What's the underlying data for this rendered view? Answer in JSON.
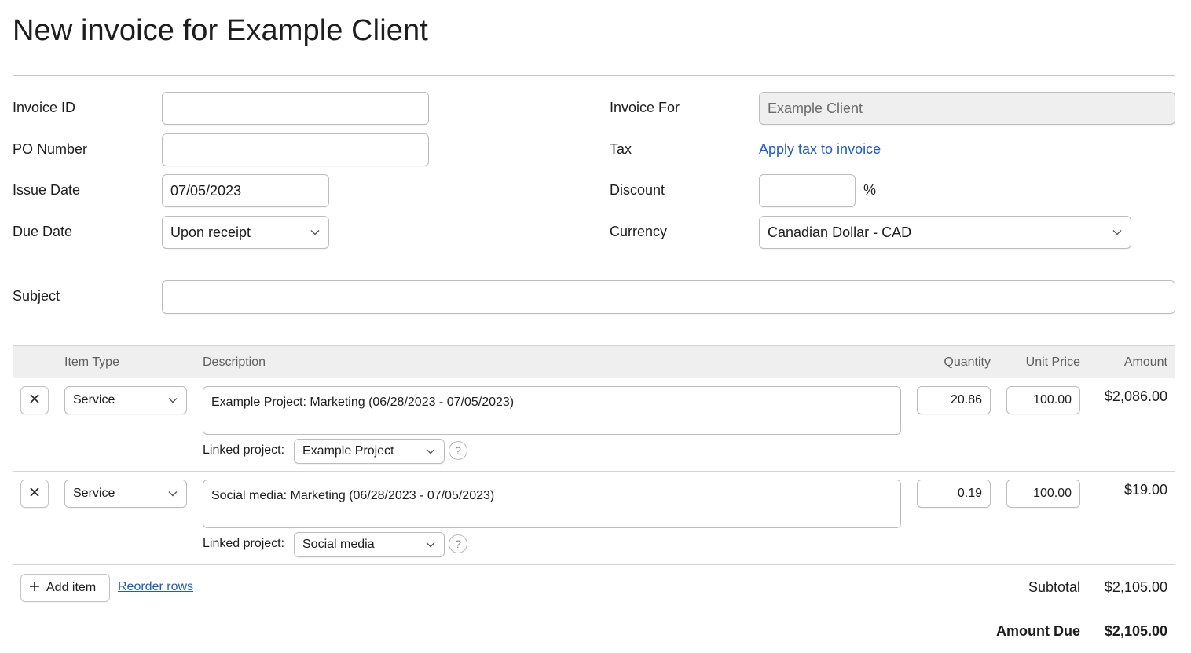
{
  "page": {
    "title": "New invoice for Example Client"
  },
  "form": {
    "invoice_id": {
      "label": "Invoice ID",
      "value": ""
    },
    "po_number": {
      "label": "PO Number",
      "value": ""
    },
    "issue_date": {
      "label": "Issue Date",
      "value": "07/05/2023"
    },
    "due_date": {
      "label": "Due Date",
      "value": "Upon receipt"
    },
    "invoice_for": {
      "label": "Invoice For",
      "value": "Example Client"
    },
    "tax": {
      "label": "Tax",
      "link": "Apply tax to invoice"
    },
    "discount": {
      "label": "Discount",
      "value": "",
      "unit": "%"
    },
    "currency": {
      "label": "Currency",
      "value": "Canadian Dollar - CAD"
    },
    "subject": {
      "label": "Subject",
      "value": ""
    }
  },
  "table": {
    "headers": {
      "item_type": "Item Type",
      "description": "Description",
      "quantity": "Quantity",
      "unit_price": "Unit Price",
      "amount": "Amount"
    },
    "linked_project_label": "Linked project:",
    "help_glyph": "?",
    "rows": [
      {
        "item_type": "Service",
        "description": "Example Project: Marketing (06/28/2023 - 07/05/2023)",
        "linked_project": "Example Project",
        "quantity": "20.86",
        "unit_price": "100.00",
        "amount": "$2,086.00"
      },
      {
        "item_type": "Service",
        "description": "Social media: Marketing (06/28/2023 - 07/05/2023)",
        "linked_project": "Social media",
        "quantity": "0.19",
        "unit_price": "100.00",
        "amount": "$19.00"
      }
    ]
  },
  "actions": {
    "add_item": "Add item",
    "reorder_rows": "Reorder rows"
  },
  "totals": {
    "subtotal_label": "Subtotal",
    "subtotal_value": "$2,105.00",
    "amount_due_label": "Amount Due",
    "amount_due_value": "$2,105.00"
  },
  "colors": {
    "link": "#1f5bc4",
    "header_bg": "#efefef",
    "disabled_bg": "#efefef"
  }
}
